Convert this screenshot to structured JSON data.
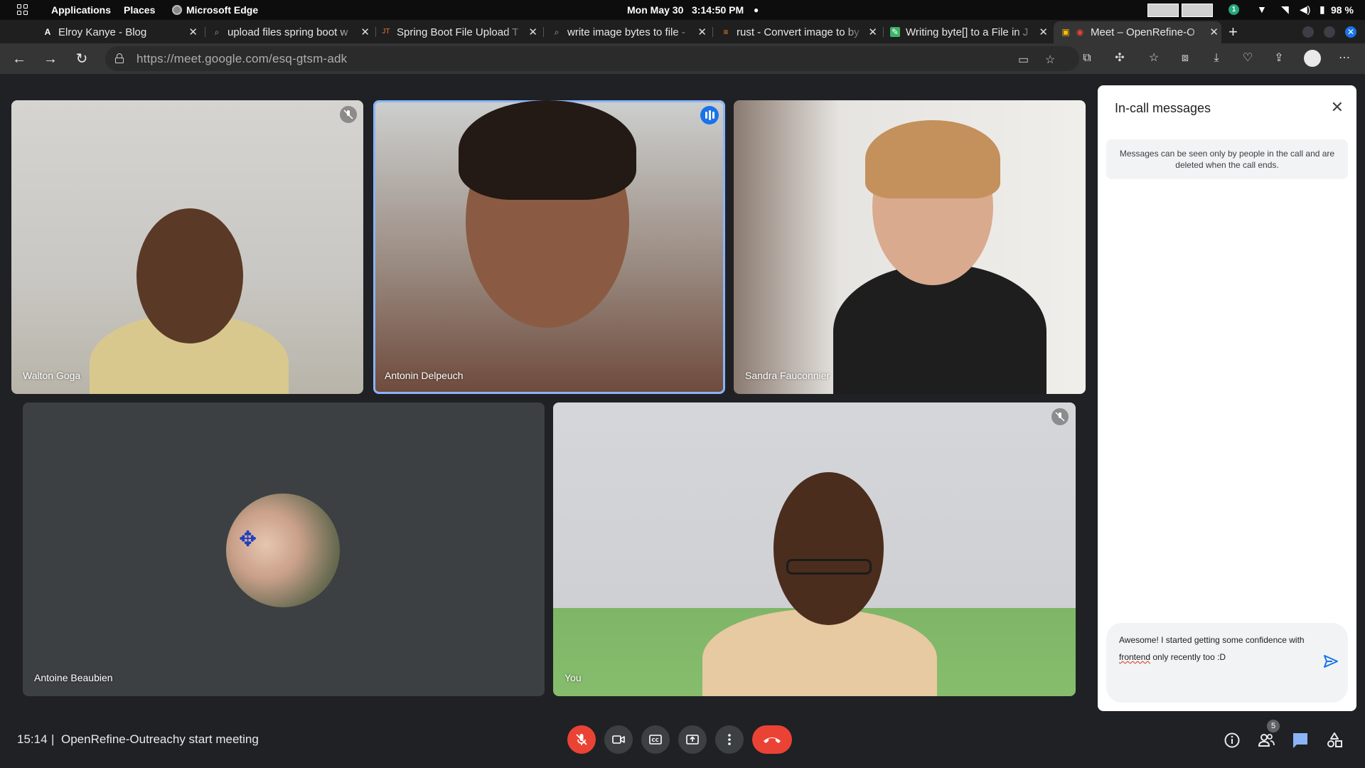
{
  "os": {
    "apps_menu": "Applications",
    "places_menu": "Places",
    "active_app": "Microsoft Edge",
    "clock": "Mon May 30   3:14:50 PM",
    "notification_count": "1",
    "battery": "98 %"
  },
  "tabs": [
    {
      "title": "Elroy Kanye - Blog",
      "icon": "A"
    },
    {
      "title": "upload files spring boot w",
      "icon": "search"
    },
    {
      "title": "Spring Boot File Upload T",
      "icon": "JT"
    },
    {
      "title": "write image bytes to file -",
      "icon": "search"
    },
    {
      "title": "rust - Convert image to by",
      "icon": "stackoverflow"
    },
    {
      "title": "Writing byte[] to a File in J",
      "icon": "page"
    },
    {
      "title": "Meet – OpenRefine-O",
      "icon": "meet"
    }
  ],
  "address_bar": {
    "url": "https://meet.google.com/esq-gtsm-adk"
  },
  "participants": [
    {
      "name": "Walton Goga",
      "muted": true
    },
    {
      "name": "Antonin Delpeuch",
      "speaking": true
    },
    {
      "name": "Sandra Fauconnier"
    },
    {
      "name": "Antoine Beaubien",
      "camera_off": true
    },
    {
      "name": "You",
      "muted": true
    }
  ],
  "chat": {
    "title": "In-call messages",
    "notice": "Messages can be seen only by people in the call and are deleted when the call ends.",
    "draft_before": "Awesome! I started getting some confidence with ",
    "draft_misspelled": "frontend",
    "draft_after": " only recently too :D"
  },
  "meeting": {
    "time": "15:14",
    "separator": "|",
    "title": "OpenRefine-Outreachy start meeting",
    "people_count": "5"
  },
  "colors": {
    "meet_bg": "#202124",
    "hangup_red": "#ea4335",
    "active_speaker": "#8ab4f8",
    "accent_blue": "#1a73e8"
  }
}
